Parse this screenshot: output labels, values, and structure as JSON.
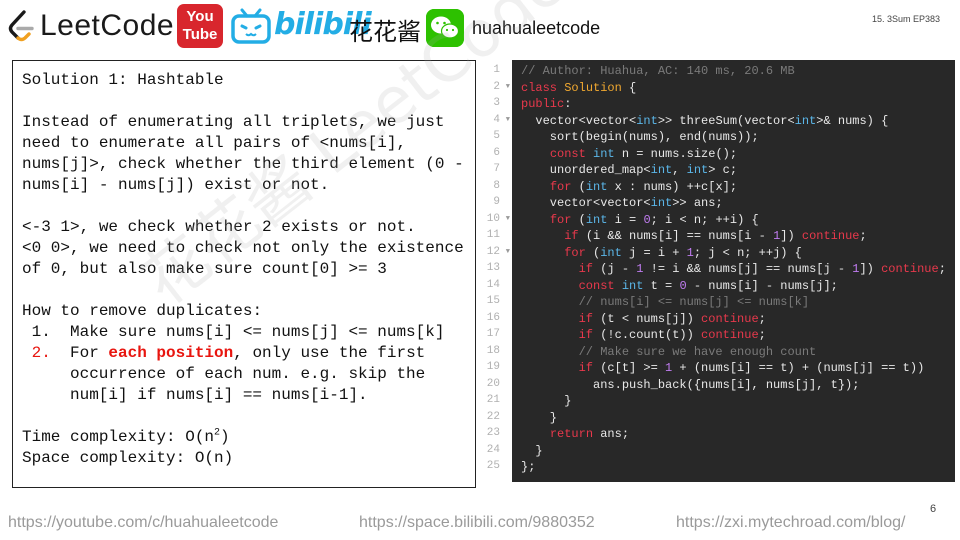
{
  "header": {
    "leetcode_logo_text": "LeetCode",
    "youtube_you": "You",
    "youtube_tube": "Tube",
    "bilibili_text": "bilibili",
    "cn_name": "花花酱",
    "channel_name": "huahualeetcode",
    "episode": "15. 3Sum EP383"
  },
  "watermark": "花花酱 LeetCode https://zxi.mytechroad.com",
  "solution": {
    "title": "Solution 1: Hashtable",
    "para1": [
      "Instead of enumerating all triplets, we just",
      "need to enumerate all pairs of <nums[i],",
      "nums[j]>, check whether the third element (0 -",
      "nums[i] - nums[j]) exist or not."
    ],
    "para2": [
      "<-3 1>, we check whether 2 exists or not.",
      "<0 0>, we need to check not only the existence",
      "of 0, but also make sure count[0] >= 3"
    ],
    "dup_title": "How to remove duplicates:",
    "dup_items": [
      {
        "num": " 1.",
        "lines": [
          "Make sure nums[i] <= nums[j] <= nums[k]"
        ]
      },
      {
        "num": " 2.",
        "pre": "For ",
        "highlight": "each position",
        "post": ", only use the first",
        "lines2": [
          "occurrence of each num. e.g. skip the",
          "num[i] if nums[i] == nums[i-1]."
        ]
      }
    ],
    "time_prefix": "Time complexity: O(n",
    "time_sup": "2",
    "time_suffix": ")",
    "space": "Space complexity: O(n)"
  },
  "code": {
    "line_numbers": [
      "1",
      "2",
      "3",
      "4",
      "5",
      "6",
      "7",
      "8",
      "9",
      "10",
      "11",
      "12",
      "13",
      "14",
      "15",
      "16",
      "17",
      "18",
      "19",
      "20",
      "21",
      "22",
      "23",
      "24",
      "25"
    ],
    "fold_lines": [
      2,
      4,
      10,
      12
    ]
  },
  "footer": {
    "youtube": "https://youtube.com/c/huahualeetcode",
    "bilibili": "https://space.bilibili.com/9880352",
    "blog": "https://zxi.mytechroad.com/blog/",
    "page_number": "6"
  },
  "colors": {
    "editor_bg": "#282828",
    "keyword": "#e8394c",
    "type": "#5bb6e8",
    "number": "#c07cf0",
    "class_name": "#f0a830",
    "comment": "#7a7a7a",
    "highlight_red": "#e8150f"
  },
  "icons": [
    "leetcode-logo",
    "youtube-logo",
    "bilibili-tv-icon",
    "wechat-icon"
  ]
}
